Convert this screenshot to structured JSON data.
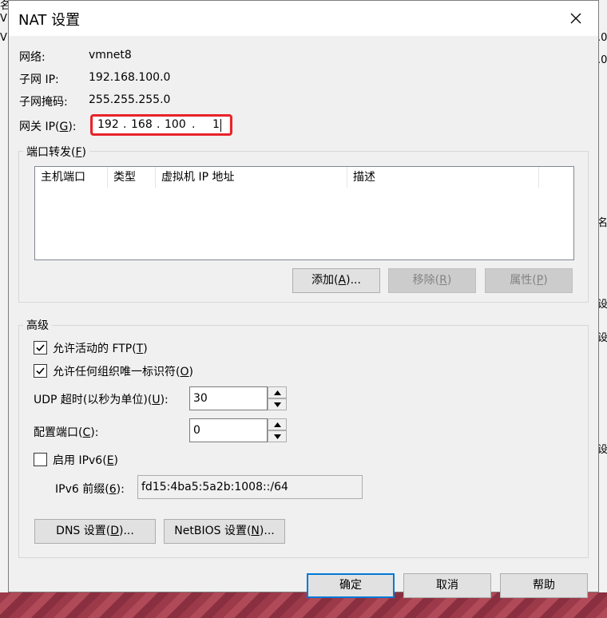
{
  "background": {
    "left_fragments": [
      "名",
      "V",
      "V"
    ],
    "right_fragments": [
      ".0",
      ".0",
      "名",
      "设",
      "设",
      "设"
    ]
  },
  "dialog": {
    "title": "NAT 设置",
    "close_glyph": "✕"
  },
  "info": {
    "network_label": "网络:",
    "network_value": "vmnet8",
    "subnet_ip_label": "子网 IP:",
    "subnet_ip_value": "192.168.100.0",
    "subnet_mask_label": "子网掩码:",
    "subnet_mask_value": "255.255.255.0",
    "gateway_label_pre": "网关 IP(",
    "gateway_label_key": "G",
    "gateway_label_post": "):",
    "gateway_octets": [
      "192",
      ".",
      "168",
      ".",
      "100",
      ".",
      "1"
    ]
  },
  "port_forwarding": {
    "title_pre": "端口转发(",
    "title_key": "F",
    "title_post": ")",
    "columns": [
      "主机端口",
      "类型",
      "虚拟机 IP 地址",
      "描述"
    ],
    "rows": [],
    "add_pre": "添加(",
    "add_key": "A",
    "add_post": ")...",
    "remove_pre": "移除(",
    "remove_key": "R",
    "remove_post": ")",
    "props_pre": "属性(",
    "props_key": "P",
    "props_post": ")"
  },
  "advanced": {
    "title": "高级",
    "ftp_pre": "允许活动的 FTP(",
    "ftp_key": "T",
    "ftp_post": ")",
    "ftp_checked": true,
    "oui_pre": "允许任何组织唯一标识符(",
    "oui_key": "O",
    "oui_post": ")",
    "oui_checked": true,
    "udp_pre": "UDP 超时(以秒为单位)(",
    "udp_key": "U",
    "udp_post": "):",
    "udp_value": "30",
    "cfg_pre": "配置端口(",
    "cfg_key": "C",
    "cfg_post": "):",
    "cfg_value": "0",
    "ipv6_pre": "启用 IPv6(",
    "ipv6_key": "E",
    "ipv6_post": ")",
    "ipv6_checked": false,
    "prefix_pre": "IPv6 前缀(",
    "prefix_key": "6",
    "prefix_post": "):",
    "prefix_value": "fd15:4ba5:5a2b:1008::/64",
    "dns_pre": "DNS 设置(",
    "dns_key": "D",
    "dns_post": ")...",
    "netbios_pre": "NetBIOS 设置(",
    "netbios_key": "N",
    "netbios_post": ")..."
  },
  "footer": {
    "ok": "确定",
    "cancel": "取消",
    "help": "帮助"
  }
}
